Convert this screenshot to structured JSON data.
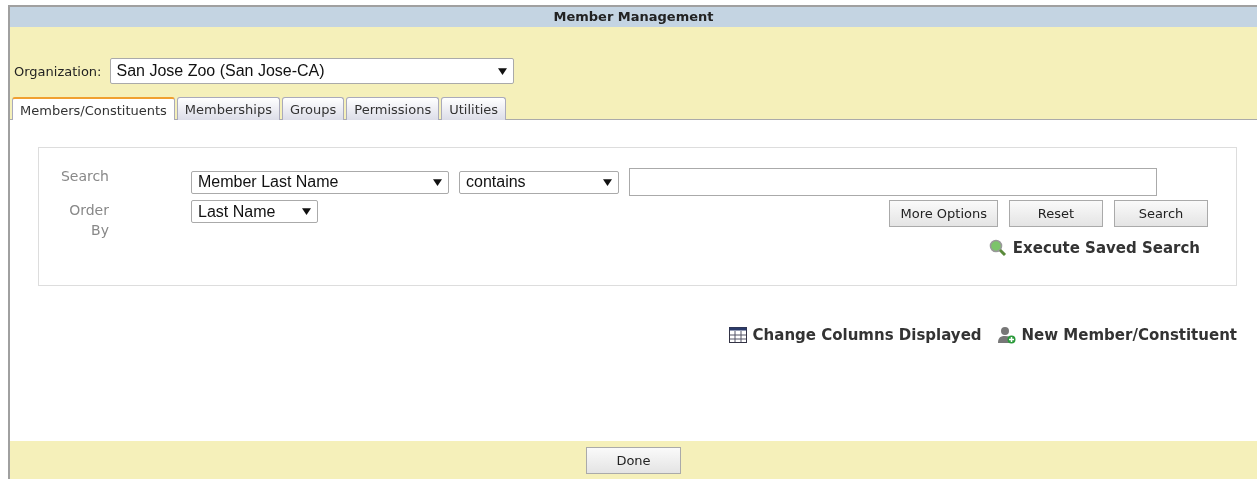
{
  "window": {
    "title": "Member Management"
  },
  "organization": {
    "label": "Organization:",
    "value": "San Jose Zoo (San Jose-CA)"
  },
  "tabs": [
    {
      "label": "Members/Constituents",
      "selected": true
    },
    {
      "label": "Memberships",
      "selected": false
    },
    {
      "label": "Groups",
      "selected": false
    },
    {
      "label": "Permissions",
      "selected": false
    },
    {
      "label": "Utilities",
      "selected": false
    }
  ],
  "search": {
    "label": "Search",
    "field": "Member Last Name",
    "operator": "contains",
    "order_label": "Order By",
    "order": "Last Name",
    "buttons": [
      "More Options",
      "Reset",
      "Search"
    ],
    "saved_search": "Execute Saved Search"
  },
  "links": [
    {
      "kind": "columns",
      "label": "Change Columns Displayed"
    },
    {
      "kind": "new",
      "label": "New Member/Constituent"
    }
  ],
  "footer": {
    "button": "Done"
  }
}
